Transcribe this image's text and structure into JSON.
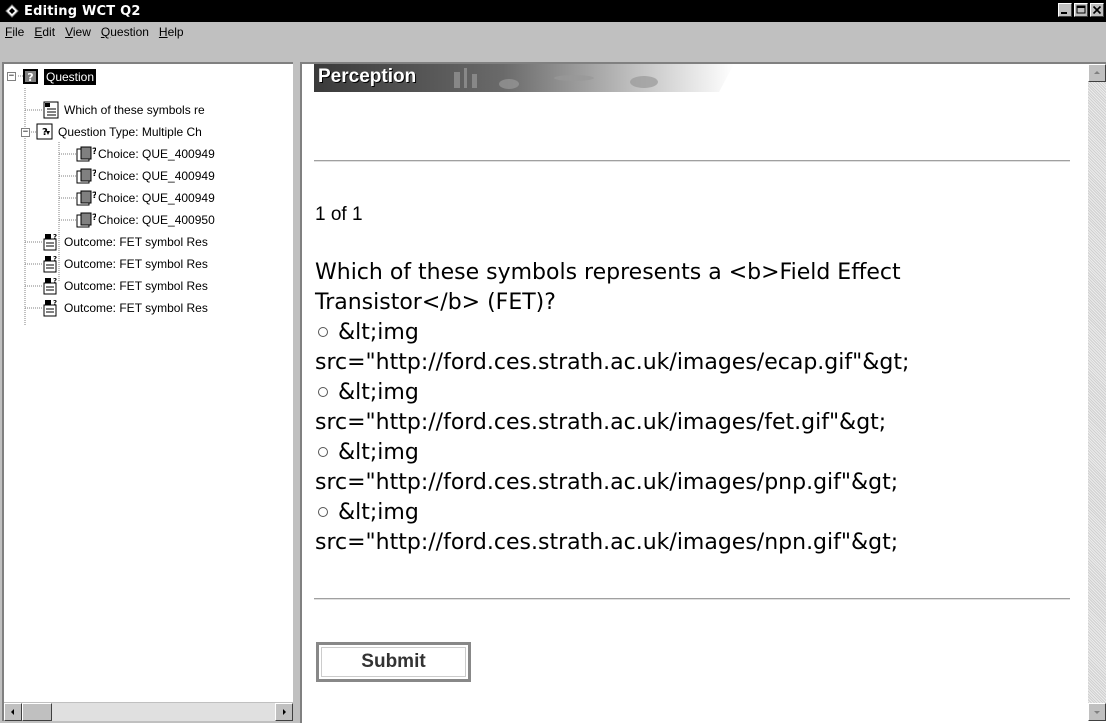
{
  "window": {
    "title": "Editing WCT Q2",
    "controls": [
      "minimize",
      "maximize",
      "close"
    ]
  },
  "menubar": {
    "items": [
      {
        "label": "File",
        "mnemonic": "F",
        "rest": "ile"
      },
      {
        "label": "Edit",
        "mnemonic": "E",
        "rest": "dit"
      },
      {
        "label": "View",
        "mnemonic": "V",
        "rest": "iew"
      },
      {
        "label": "Question",
        "mnemonic": "Q",
        "rest": "uestion"
      },
      {
        "label": "Help",
        "mnemonic": "H",
        "rest": "elp"
      }
    ]
  },
  "tree": {
    "root": {
      "label": "Question",
      "icon": "question-icon",
      "selected": true
    },
    "items": [
      {
        "label": "Which of these symbols re",
        "icon": "text-document-icon"
      },
      {
        "label": "Question Type: Multiple Ch",
        "icon": "question-type-icon"
      },
      {
        "label": "Choice: QUE_400949",
        "icon": "choice-icon"
      },
      {
        "label": "Choice: QUE_400949",
        "icon": "choice-icon"
      },
      {
        "label": "Choice: QUE_400949",
        "icon": "choice-icon"
      },
      {
        "label": "Choice: QUE_400950",
        "icon": "choice-icon"
      },
      {
        "label": "Outcome: FET symbol Res",
        "icon": "outcome-icon"
      },
      {
        "label": "Outcome: FET symbol Res",
        "icon": "outcome-icon"
      },
      {
        "label": "Outcome: FET symbol Res",
        "icon": "outcome-icon"
      },
      {
        "label": "Outcome: FET symbol Res",
        "icon": "outcome-icon"
      }
    ]
  },
  "preview": {
    "banner_brand": "Perception",
    "counter": "1 of 1",
    "question_line1": "Which of these symbols represents a <b>Field Effect",
    "question_line2": "Transistor</b> (FET)?",
    "choices": [
      {
        "line1": "&lt;img",
        "line2": "src=\"http://ford.ces.strath.ac.uk/images/ecap.gif\"&gt;"
      },
      {
        "line1": "&lt;img",
        "line2": "src=\"http://ford.ces.strath.ac.uk/images/fet.gif\"&gt;"
      },
      {
        "line1": "&lt;img",
        "line2": "src=\"http://ford.ces.strath.ac.uk/images/pnp.gif\"&gt;"
      },
      {
        "line1": "&lt;img",
        "line2": "src=\"http://ford.ces.strath.ac.uk/images/npn.gif\"&gt;"
      }
    ],
    "submit_label": "Submit"
  }
}
